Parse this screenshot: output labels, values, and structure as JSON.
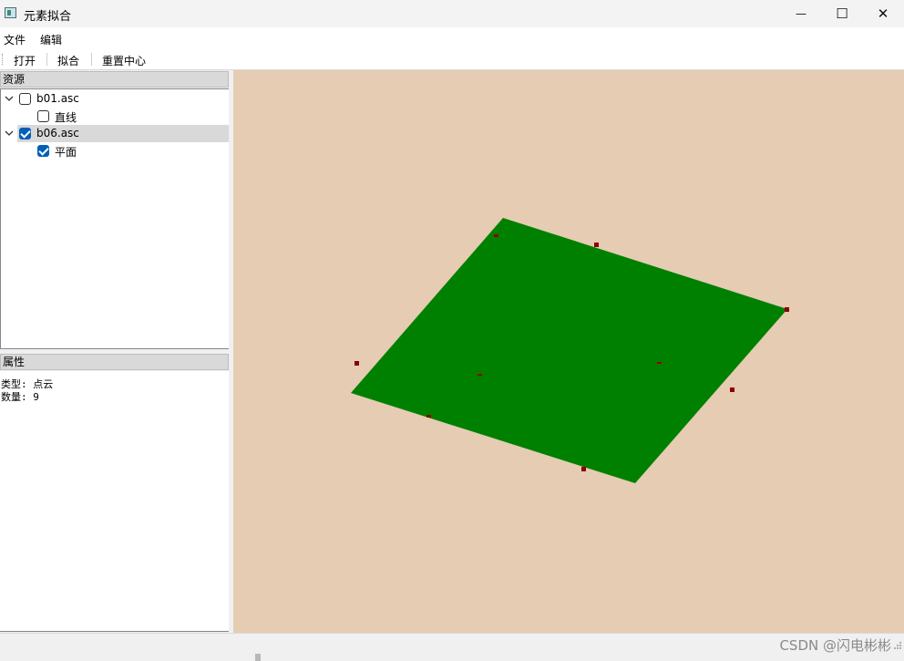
{
  "window": {
    "title": "元素拟合",
    "minimize_glyph": "—",
    "maximize_glyph": "☐",
    "close_glyph": "✕"
  },
  "menu": {
    "file": "文件",
    "edit": "编辑"
  },
  "toolbar": {
    "open": "打开",
    "fit": "拟合",
    "reset_center": "重置中心"
  },
  "resources": {
    "header": "资源",
    "items": [
      {
        "label": "b01.asc",
        "checked": false,
        "expanded": true,
        "children": [
          {
            "label": "直线",
            "checked": false
          }
        ]
      },
      {
        "label": "b06.asc",
        "checked": true,
        "expanded": true,
        "selected": true,
        "children": [
          {
            "label": "平面",
            "checked": true
          }
        ]
      }
    ]
  },
  "properties": {
    "header": "属性",
    "lines": [
      "类型: 点云",
      "数量: 9"
    ]
  },
  "viewport": {
    "background": "#e5ccb3",
    "plane_color": "#008000",
    "point_color": "#8b0000",
    "point_count": 9
  },
  "status": {
    "watermark": "CSDN @闪电彬彬"
  }
}
